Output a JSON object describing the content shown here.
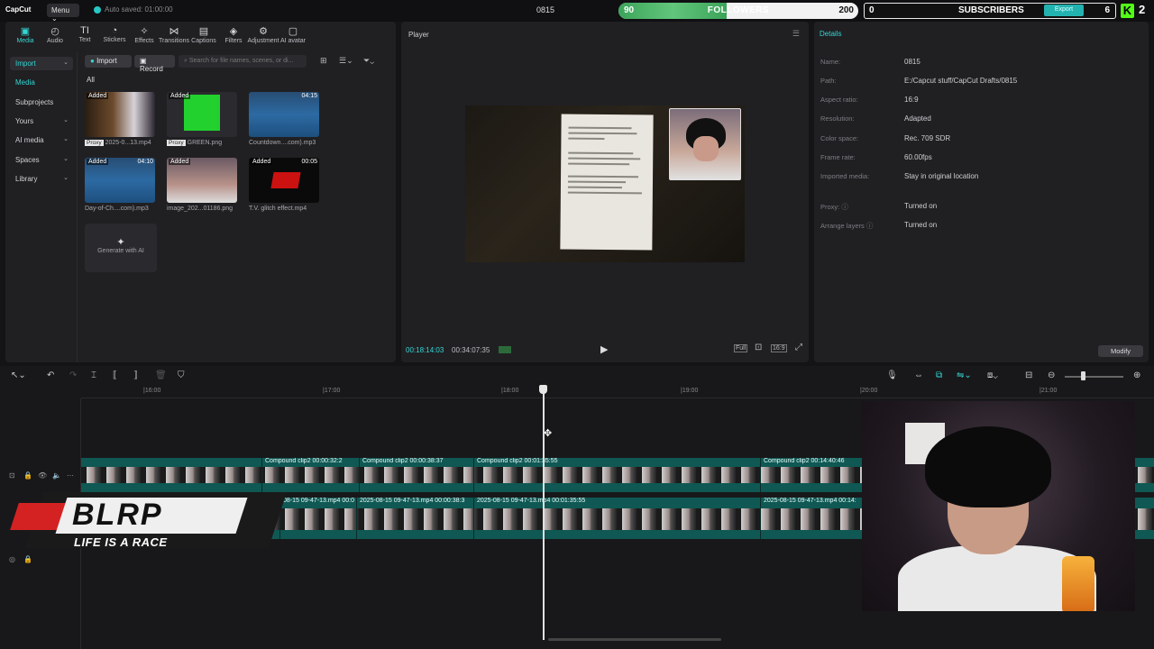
{
  "app": {
    "logo_text": "CapCut",
    "menu_label": "Menu",
    "autosave_text": "Auto saved: 01:00:00",
    "project_title": "0815"
  },
  "overlay": {
    "followers": {
      "current": "90",
      "label": "FOLLOWERS",
      "goal": "200",
      "progress": 0.45
    },
    "subscribers": {
      "current": "0",
      "label": "SUBSCRIBERS",
      "goal": "6",
      "export_label": "Export"
    },
    "kick_count": "2",
    "blrp_title": "BLRP",
    "blrp_tagline": "LIFE IS A RACE",
    "colors": {
      "accent": "#35d5d2",
      "followers_fill": "#4cb86a",
      "kick_green": "#53fc18"
    }
  },
  "toolbar_tabs": [
    {
      "label": "Media",
      "icon": "media-icon",
      "glyph": "▣",
      "active": true
    },
    {
      "label": "Audio",
      "icon": "audio-icon",
      "glyph": "◴"
    },
    {
      "label": "Text",
      "icon": "text-icon",
      "glyph": "TI"
    },
    {
      "label": "Stickers",
      "icon": "sticker-icon",
      "glyph": "◔"
    },
    {
      "label": "Effects",
      "icon": "effects-icon",
      "glyph": "✧"
    },
    {
      "label": "Transitions",
      "icon": "transitions-icon",
      "glyph": "⋈"
    },
    {
      "label": "Captions",
      "icon": "captions-icon",
      "glyph": "▤"
    },
    {
      "label": "Filters",
      "icon": "filters-icon",
      "glyph": "◈"
    },
    {
      "label": "Adjustment",
      "icon": "adjustment-icon",
      "glyph": "⚙"
    },
    {
      "label": "AI avatar",
      "icon": "ai-avatar-icon",
      "glyph": "▢"
    }
  ],
  "side_nav": [
    {
      "label": "Import",
      "selected": true,
      "chevron": true
    },
    {
      "label": "Media",
      "accent": true
    },
    {
      "label": "Subprojects"
    },
    {
      "label": "Yours",
      "chevron": true
    },
    {
      "label": "AI media",
      "chevron": true
    },
    {
      "label": "Spaces",
      "chevron": true
    },
    {
      "label": "Library",
      "chevron": true
    }
  ],
  "media_toolbar": {
    "import_label": "Import",
    "record_label": "Record",
    "search_placeholder": "Search for file names, scenes, or di...",
    "filter_all": "All"
  },
  "media_items": [
    {
      "name": "2025-0...13.mp4",
      "badge": "Added",
      "proxy": "Proxy",
      "kind": "video"
    },
    {
      "name": "GREEN.png",
      "badge": "Added",
      "proxy": "Proxy",
      "kind": "green"
    },
    {
      "name": "Countdown....com).mp3",
      "badge": "",
      "duration": "04:15",
      "kind": "audio"
    },
    {
      "name": "Day-of-Ch....com).mp3",
      "badge": "Added",
      "duration": "04:10",
      "kind": "audio"
    },
    {
      "name": "image_202...01186.png",
      "badge": "Added",
      "kind": "face"
    },
    {
      "name": "T.V. glitch effect.mp4",
      "badge": "Added",
      "duration": "00:05",
      "kind": "glitch"
    }
  ],
  "generate_ai_label": "Generate with AI",
  "player": {
    "title": "Player",
    "current_time": "00:18:14:03",
    "total_time": "00:34:07:35",
    "full_label": "Full",
    "ratio_label": "16:9"
  },
  "details": {
    "title": "Details",
    "rows": [
      {
        "key": "Name:",
        "value": "0815"
      },
      {
        "key": "Path:",
        "value": "E:/Capcut stuff/CapCut Drafts/0815"
      },
      {
        "key": "Aspect ratio:",
        "value": "16:9"
      },
      {
        "key": "Resolution:",
        "value": "Adapted"
      },
      {
        "key": "Color space:",
        "value": "Rec. 709 SDR"
      },
      {
        "key": "Frame rate:",
        "value": "60.00fps"
      },
      {
        "key": "Imported media:",
        "value": "Stay in original location"
      },
      {
        "key": "Proxy: ⓘ",
        "value": "Turned on"
      },
      {
        "key": "Arrange layers ⓘ",
        "value": "Turned on"
      }
    ],
    "modify_label": "Modify"
  },
  "timeline": {
    "ruler_ticks": [
      "|16:00",
      "|17:00",
      "|18:00",
      "|19:00",
      "|20:00",
      "|21:00"
    ],
    "compound_clips": [
      {
        "label": "Compound clip2  00:00:32:2"
      },
      {
        "label": "Compound clip2  00:00:38:37"
      },
      {
        "label": "Compound clip2  00:01:35:55"
      },
      {
        "label": "Compound clip2  00:14:40:46"
      }
    ],
    "video_clips": [
      {
        "label": "08-15 09-47-13.mp4  00:0"
      },
      {
        "label": "2025-08-15 09-47-13.mp4  00:00:38:3"
      },
      {
        "label": "2025-08-15 09-47-13.mp4  00:01:35:55"
      },
      {
        "label": "2025-08-15 09-47-13.mp4  00:14:"
      }
    ]
  }
}
